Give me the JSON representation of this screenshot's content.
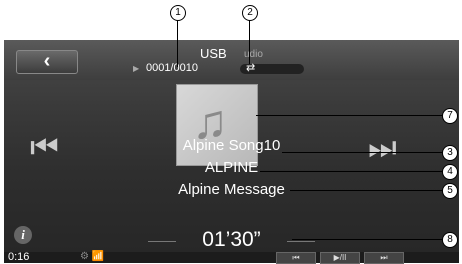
{
  "header": {
    "back_label": "‹",
    "source": "USB",
    "source_sub": "udio",
    "track_count": "0001/0010"
  },
  "now_playing": {
    "song": "Alpine Song10",
    "artist": "ALPINE",
    "album": "Alpine Message",
    "total_time": "01’30”"
  },
  "footer": {
    "elapsed": "0:16",
    "status": "⚙ 📶",
    "controls": [
      "⏮",
      "▶/II",
      "⏭"
    ]
  },
  "callouts": [
    "1",
    "2",
    "3",
    "4",
    "5",
    "7",
    "8"
  ],
  "icons": {
    "info": "i",
    "music_note": "♫",
    "prev": "⏮",
    "next": "⏭",
    "repeat": "⇄"
  }
}
